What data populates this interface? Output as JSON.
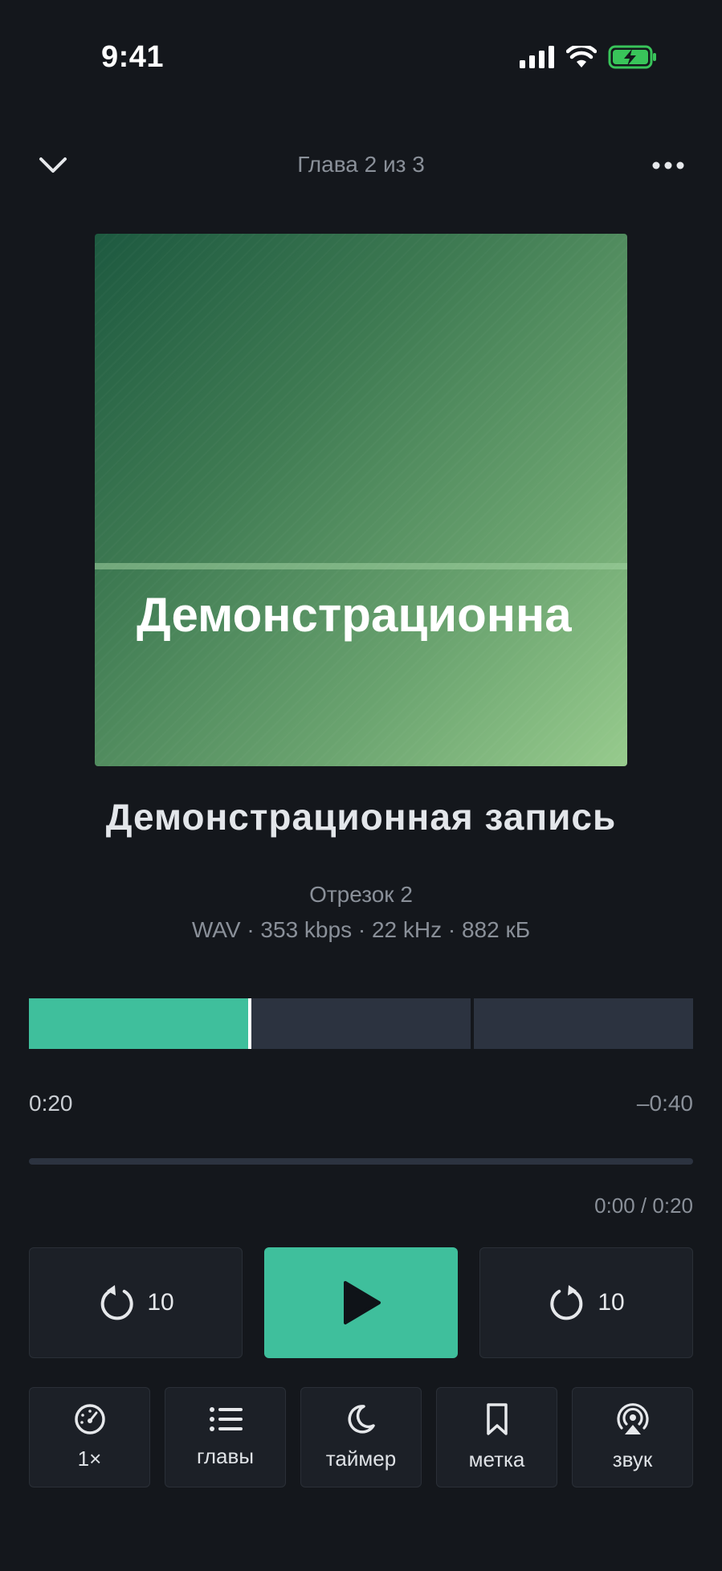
{
  "status": {
    "time": "9:41"
  },
  "header": {
    "title": "Глава 2 из 3",
    "collapse_icon": "chevron-down-icon",
    "more_icon": "more-horizontal-icon"
  },
  "artwork": {
    "text": "Демонстрационна"
  },
  "track": {
    "title": "Демонстрационная  запись",
    "subtitle": "Отрезок 2",
    "meta": "WAV · 353 kbps · 22 kHz · 882 кБ"
  },
  "chapters": {
    "count": 3,
    "current": 2,
    "progress_fraction": 0.33
  },
  "times": {
    "elapsed": "0:20",
    "remaining": "–0:40",
    "chapter": "0:00 / 0:20"
  },
  "controls": {
    "back_label": "10",
    "forward_label": "10",
    "accent": "#3fbf9c"
  },
  "tools": [
    {
      "label": "1×",
      "icon": "speedometer-icon"
    },
    {
      "label": "главы",
      "icon": "list-icon"
    },
    {
      "label": "таймер",
      "icon": "moon-icon"
    },
    {
      "label": "метка",
      "icon": "bookmark-icon"
    },
    {
      "label": "звук",
      "icon": "airplay-audio-icon"
    }
  ]
}
